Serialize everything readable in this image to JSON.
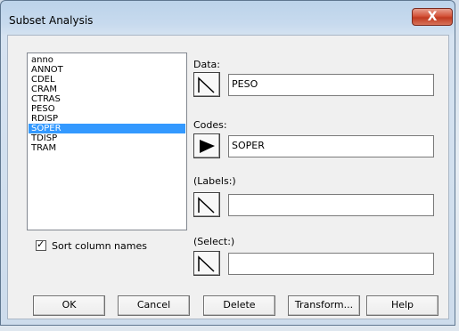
{
  "window": {
    "title": "Subset Analysis",
    "close_glyph": "X"
  },
  "list": {
    "items": [
      "anno",
      "ANNOT",
      "CDEL",
      "CRAM",
      "CTRAS",
      "PESO",
      "RDISP",
      "SOPER",
      "TDISP",
      "TRAM"
    ],
    "selected_index": 7
  },
  "sort_checkbox": {
    "label": "Sort column names",
    "checked": true,
    "check_glyph": "✓"
  },
  "fields": {
    "data": {
      "label": "Data:",
      "value": "PESO"
    },
    "codes": {
      "label": "Codes:",
      "value": "SOPER"
    },
    "labels": {
      "label": "(Labels:)",
      "value": ""
    },
    "select": {
      "label": "(Select:)",
      "value": ""
    }
  },
  "buttons": {
    "ok": "OK",
    "cancel": "Cancel",
    "delete": "Delete",
    "transform": "Transform...",
    "help": "Help"
  },
  "colors": {
    "selection": "#3399ff",
    "close": "#c13b21"
  }
}
